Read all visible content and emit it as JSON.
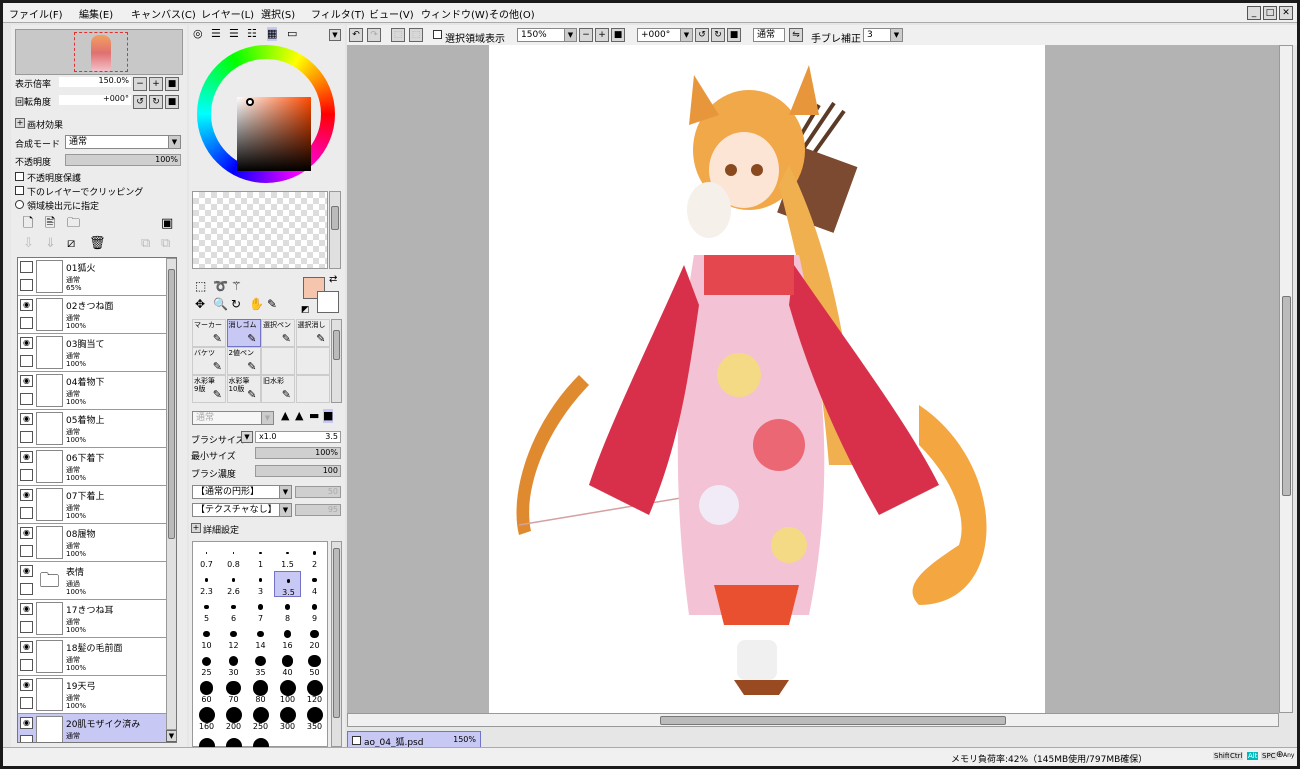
{
  "menu": [
    "ファイル(F)",
    "編集(E)",
    "キャンバス(C)",
    "レイヤー(L)",
    "選択(S)",
    "フィルタ(T)",
    "ビュー(V)",
    "ウィンドウ(W)",
    "その他(O)"
  ],
  "window_buttons": [
    "_",
    "□",
    "✕"
  ],
  "navigator": {
    "zoom_label": "表示倍率",
    "zoom_value": "150.0%",
    "rotate_label": "回転角度",
    "rotate_value": "+000°"
  },
  "layer_panel": {
    "effects_label": "画材効果",
    "blend_label": "合成モード",
    "blend_value": "通常",
    "opacity_label": "不透明度",
    "opacity_value": "100%",
    "check_preserve": "不透明度保護",
    "check_clip": "下のレイヤーでクリッピング",
    "check_source": "領域検出元に指定",
    "layers": [
      {
        "name": "01狐火",
        "mode": "通常",
        "opacity": "65%",
        "visible": false,
        "folder": false
      },
      {
        "name": "02きつね面",
        "mode": "通常",
        "opacity": "100%",
        "visible": true,
        "folder": false
      },
      {
        "name": "03胸当て",
        "mode": "通常",
        "opacity": "100%",
        "visible": true,
        "folder": false
      },
      {
        "name": "04着物下",
        "mode": "通常",
        "opacity": "100%",
        "visible": true,
        "folder": false
      },
      {
        "name": "05着物上",
        "mode": "通常",
        "opacity": "100%",
        "visible": true,
        "folder": false
      },
      {
        "name": "06下着下",
        "mode": "通常",
        "opacity": "100%",
        "visible": true,
        "folder": false
      },
      {
        "name": "07下着上",
        "mode": "通常",
        "opacity": "100%",
        "visible": true,
        "folder": false
      },
      {
        "name": "08履物",
        "mode": "通常",
        "opacity": "100%",
        "visible": true,
        "folder": false
      },
      {
        "name": "表情",
        "mode": "通過",
        "opacity": "100%",
        "visible": true,
        "folder": true
      },
      {
        "name": "17きつね耳",
        "mode": "通常",
        "opacity": "100%",
        "visible": true,
        "folder": false
      },
      {
        "name": "18髪の毛前面",
        "mode": "通常",
        "opacity": "100%",
        "visible": true,
        "folder": false
      },
      {
        "name": "19天弓",
        "mode": "通常",
        "opacity": "100%",
        "visible": true,
        "folder": false
      },
      {
        "name": "20肌モザイク済み",
        "mode": "通常",
        "opacity": "",
        "visible": true,
        "folder": false,
        "selected": true
      }
    ]
  },
  "tools": {
    "rows": [
      [
        "マーカー",
        "消しゴム",
        "選択ペン",
        "選択消し"
      ],
      [
        "バケツ",
        "2値ペン",
        "",
        ""
      ],
      [
        "水彩筆\n9版",
        "水彩筆\n10版",
        "旧水彩",
        ""
      ]
    ],
    "selected": "消しゴム",
    "blend_value": "通常",
    "brush_size_label": "ブラシサイズ",
    "brush_size_mult": "x1.0",
    "brush_size_value": "3.5",
    "min_size_label": "最小サイズ",
    "min_size_value": "100%",
    "density_label": "ブラシ濃度",
    "density_value": "100",
    "shape_value": "【通常の円形】",
    "shape_num": "50",
    "texture_value": "【テクスチャなし】",
    "texture_num": "95",
    "detail_label": "詳細設定",
    "brush_sizes": [
      "0.7",
      "0.8",
      "1",
      "1.5",
      "2",
      "2.3",
      "2.6",
      "3",
      "3.5",
      "4",
      "5",
      "6",
      "7",
      "8",
      "9",
      "10",
      "12",
      "14",
      "16",
      "20",
      "25",
      "30",
      "35",
      "40",
      "50",
      "60",
      "70",
      "80",
      "100",
      "120",
      "160",
      "200",
      "250",
      "300",
      "350",
      "",
      "",
      ""
    ],
    "brush_selected": "3.5"
  },
  "canvas_toolbar": {
    "show_selection_label": "選択領域表示",
    "zoom_value": "150%",
    "angle_value": "+000°",
    "mode_value": "通常",
    "stabilizer_label": "手ブレ補正",
    "stabilizer_value": "3"
  },
  "document_tab": {
    "name": "ao_04_狐.psd",
    "zoom": "150%"
  },
  "status": {
    "memory": "メモリ負荷率:42%（145MB使用/797MB確保）",
    "keys": [
      "Shift",
      "Ctrl",
      "Alt",
      "SPC",
      "⊕",
      "Any"
    ]
  },
  "colors": {
    "primary": "#f5c6ad",
    "secondary": "#ffffff",
    "selection": "#c8c8f4"
  }
}
